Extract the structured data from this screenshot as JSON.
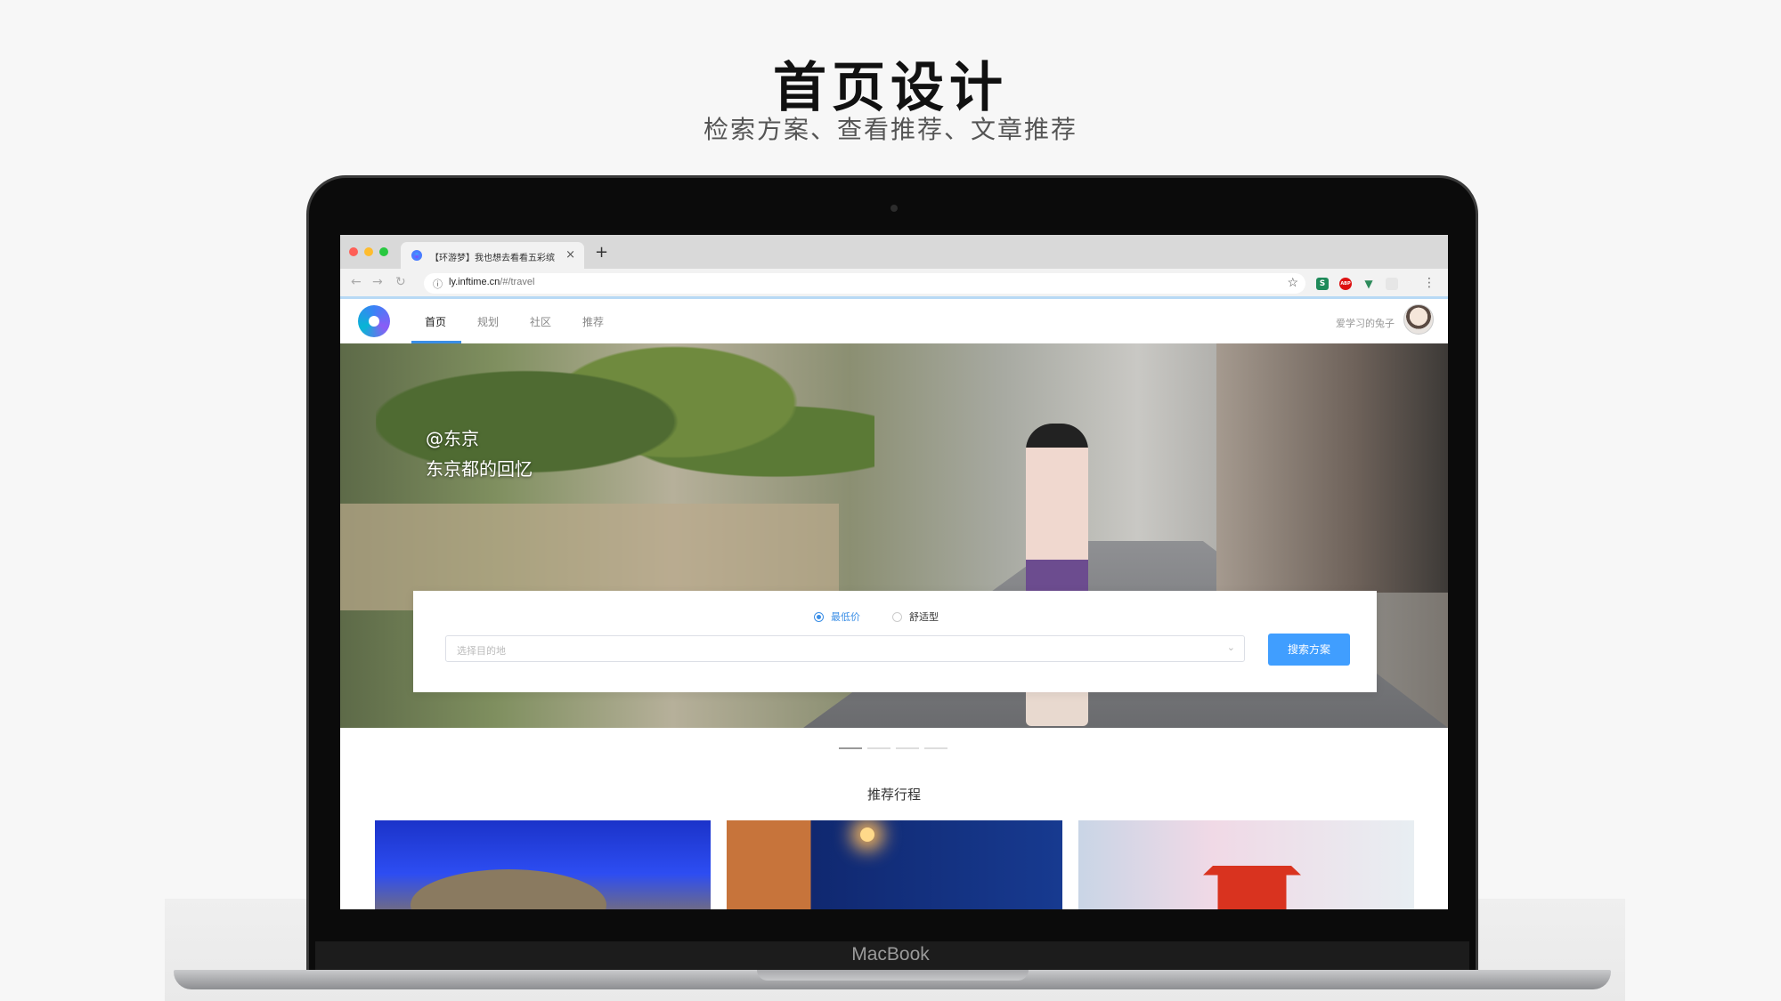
{
  "header": {
    "title": "首页设计",
    "subtitle": "检索方案、查看推荐、文章推荐"
  },
  "laptop": {
    "brand": "MacBook"
  },
  "browser": {
    "tab_title": "【环游梦】我也想去看看五彩缤",
    "tab_close": "×",
    "new_tab": "+",
    "url_host": "ly.inftime.cn",
    "url_path": "/#/travel",
    "extension_s": "S",
    "extension_abp": "ABP"
  },
  "app": {
    "nav": [
      {
        "label": "首页",
        "active": true
      },
      {
        "label": "规划",
        "active": false
      },
      {
        "label": "社区",
        "active": false
      },
      {
        "label": "推荐",
        "active": false
      }
    ],
    "username": "爱学习的兔子"
  },
  "hero": {
    "location": "@东京",
    "caption": "东京都的回忆"
  },
  "search": {
    "options": [
      {
        "label": "最低价",
        "checked": true
      },
      {
        "label": "舒适型",
        "checked": false
      }
    ],
    "destination_placeholder": "选择目的地",
    "button_label": "搜索方案"
  },
  "carousel": {
    "count": 4,
    "active_index": 0
  },
  "recommend": {
    "title": "推荐行程",
    "cards": [
      {
        "image": "colosseum-night"
      },
      {
        "image": "city-night-lamp"
      },
      {
        "image": "red-pagoda-cherry-blossom"
      }
    ]
  },
  "colors": {
    "accent": "#409eff",
    "nav_underline": "#3a8ee6",
    "page_background": "#f7f7f7"
  }
}
